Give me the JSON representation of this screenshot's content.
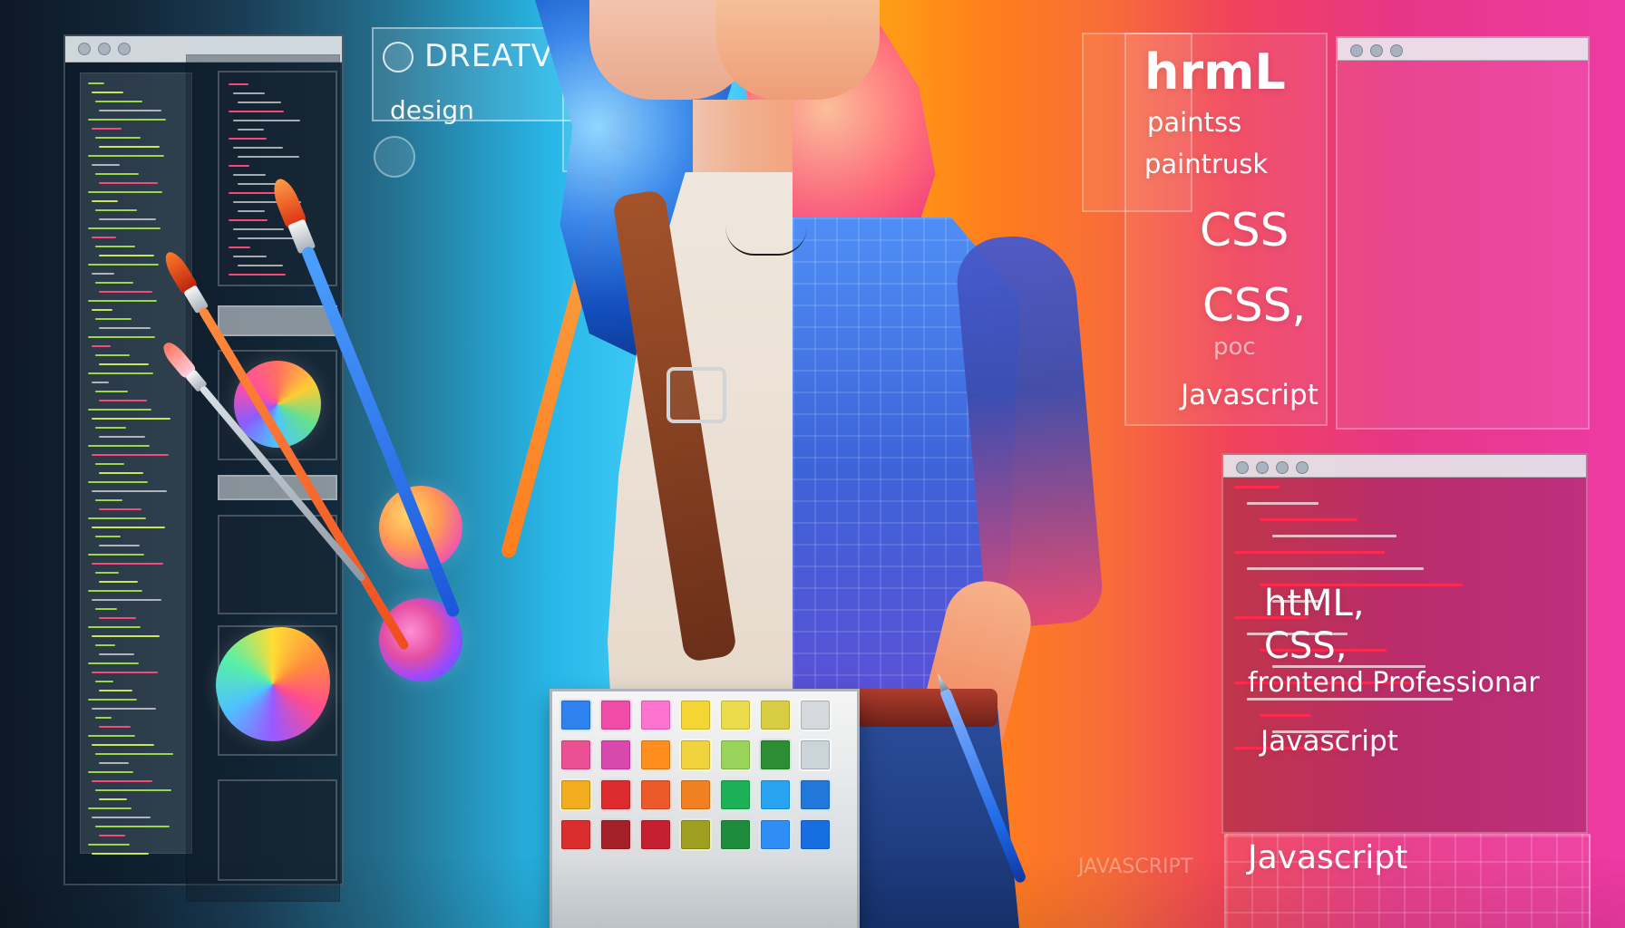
{
  "top_left_brand": {
    "text": "DREATVIGNN",
    "subtext": "design"
  },
  "right_labels": {
    "html": "hrmL",
    "paints": "paintss",
    "paintbrush": "paintrusk",
    "css_1": "CSS",
    "css_2": "CSS,",
    "small_word": "poc",
    "javascript_1": "Javascript"
  },
  "right_code_panel": {
    "html": "htML,",
    "css": "CSS,",
    "headline": "frontend Professionar",
    "javascript": "Javascript"
  },
  "bottom_labels": {
    "javascript_ghost": "JAVASCRIPT",
    "javascript_bottom": "Javascript"
  },
  "icons": {
    "left_panel_dots": "window-dots-icon",
    "brand_symbol": "design-logo-icon",
    "palette": "paint-palette-icon",
    "brush": "paintbrush-icon",
    "pen": "pen-icon"
  },
  "colors": {
    "cool_side": "#28b7e8",
    "warm_side": "#ff7e1c",
    "magenta_side": "#ee3aa4"
  }
}
